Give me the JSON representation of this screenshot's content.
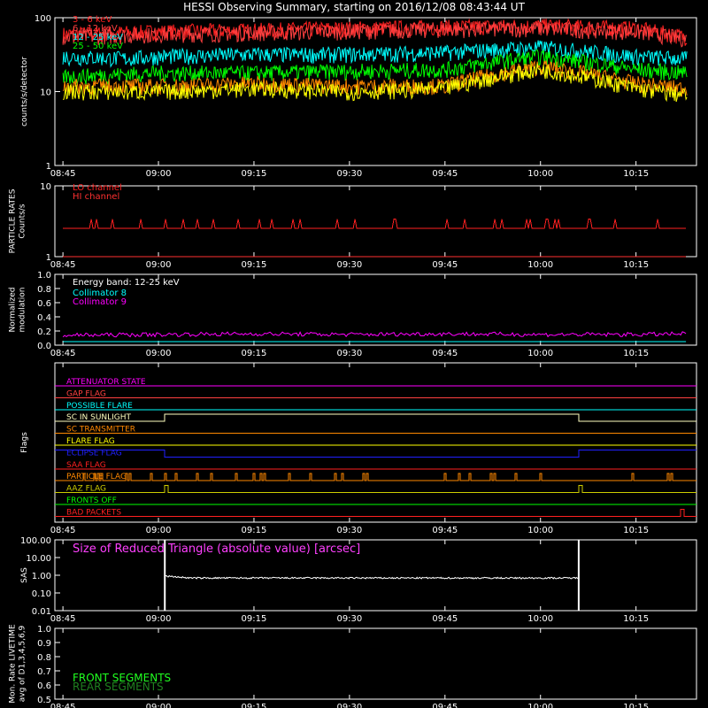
{
  "title": "HESSI Observing Summary, starting on 2016/12/08 08:43:44 UT",
  "time_ticks": [
    "08:45",
    "09:00",
    "09:15",
    "09:30",
    "09:45",
    "10:00",
    "10:15"
  ],
  "chart_data": [
    {
      "id": "lightcurves",
      "type": "line",
      "ylabel": "counts/s/detector",
      "yscale": "log",
      "ylim": [
        1,
        100
      ],
      "yticks": [
        "1",
        "10",
        "100"
      ],
      "series": [
        {
          "name": "3 - 6 keV",
          "color": "#ff2020",
          "x": [
            "08:45",
            "09:00",
            "09:15",
            "09:30",
            "09:45",
            "10:00",
            "10:15",
            "10:23"
          ],
          "y": [
            60,
            65,
            68,
            72,
            75,
            78,
            72,
            55
          ]
        },
        {
          "name": "6 - 12 keV",
          "color": "#ff4040",
          "x": [
            "08:45",
            "09:00",
            "09:15",
            "09:30",
            "09:45",
            "10:00",
            "10:15",
            "10:23"
          ],
          "y": [
            55,
            60,
            63,
            66,
            70,
            72,
            65,
            52
          ]
        },
        {
          "name": "12 - 25 keV",
          "color": "#00ffff",
          "x": [
            "08:45",
            "08:55",
            "09:00",
            "09:15",
            "09:30",
            "09:45",
            "10:00",
            "10:15",
            "10:23"
          ],
          "y": [
            30,
            28,
            30,
            32,
            32,
            34,
            40,
            30,
            28
          ]
        },
        {
          "name": "25 - 50 keV",
          "color": "#00ff00",
          "x": [
            "08:45",
            "09:00",
            "09:15",
            "09:30",
            "09:45",
            "10:00",
            "10:15",
            "10:23"
          ],
          "y": [
            16,
            18,
            18,
            19,
            20,
            30,
            20,
            18
          ]
        },
        {
          "name": "",
          "color": "#ff8800",
          "x": [
            "08:45",
            "09:00",
            "09:15",
            "09:30",
            "09:45",
            "10:00",
            "10:15",
            "10:23"
          ],
          "y": [
            12,
            12,
            13,
            12,
            12,
            22,
            13,
            11
          ]
        },
        {
          "name": "",
          "color": "#ffff00",
          "x": [
            "08:45",
            "09:00",
            "09:15",
            "09:30",
            "09:45",
            "10:00",
            "10:15",
            "10:23"
          ],
          "y": [
            10,
            10,
            11,
            10,
            11,
            20,
            11,
            9
          ]
        }
      ]
    },
    {
      "id": "particle",
      "type": "line",
      "ylabel": "PARTICLE RATES\nCounts/s",
      "yscale": "log",
      "ylim": [
        1,
        10
      ],
      "yticks": [
        "1",
        "10"
      ],
      "series": [
        {
          "name": "LO channel",
          "color": "#ff2020",
          "x": [
            "08:45",
            "09:00",
            "09:15",
            "09:30",
            "09:45",
            "10:00",
            "10:15",
            "10:23"
          ],
          "y": [
            2.5,
            2.5,
            2.5,
            2.5,
            2.5,
            2.8,
            2.5,
            2.5
          ]
        },
        {
          "name": "HI channel",
          "color": "#ff3030",
          "x": [
            "08:45",
            "10:23"
          ],
          "y": [
            1,
            1
          ]
        }
      ]
    },
    {
      "id": "modulation",
      "type": "line",
      "ylabel": "Normalized\nmodulation",
      "ylim": [
        0,
        1.0
      ],
      "yticks": [
        "0.0",
        "0.2",
        "0.4",
        "0.6",
        "0.8",
        "1.0"
      ],
      "annotation": "Energy band: 12-25 keV",
      "series": [
        {
          "name": "Collimator 8",
          "color": "#00ffff",
          "x": [
            "08:45",
            "10:23"
          ],
          "y": [
            0.05,
            0.05
          ]
        },
        {
          "name": "Collimator 9",
          "color": "#ff00ff",
          "x": [
            "08:45",
            "09:00",
            "09:15",
            "09:30",
            "09:45",
            "10:00",
            "10:15",
            "10:23"
          ],
          "y": [
            0.14,
            0.15,
            0.16,
            0.15,
            0.16,
            0.15,
            0.15,
            0.16
          ]
        }
      ]
    },
    {
      "id": "flags",
      "type": "line",
      "ylabel": "Flags",
      "flags": [
        {
          "name": "ATTENUATOR STATE",
          "color": "#ff00ff"
        },
        {
          "name": "GAP FLAG",
          "color": "#ff4040"
        },
        {
          "name": "POSSIBLE FLARE",
          "color": "#00ffff"
        },
        {
          "name": "SC IN SUNLIGHT",
          "color": "#ffffc0",
          "high_from": "09:01",
          "high_to": "10:06"
        },
        {
          "name": "SC TRANSMITTER",
          "color": "#ff8800"
        },
        {
          "name": "FLARE FLAG",
          "color": "#ffff00"
        },
        {
          "name": "ECLIPSE FLAG",
          "color": "#2020ff",
          "high_from": "08:45",
          "high_to": "09:01",
          "high_from2": "10:06",
          "high_to2": "10:23"
        },
        {
          "name": "SAA FLAG",
          "color": "#ff2020"
        },
        {
          "name": "PARTICLE FLAG",
          "color": "#ff8800",
          "spiky": true
        },
        {
          "name": "AAZ FLAG",
          "color": "#cccc00",
          "pulses": [
            "09:01",
            "10:06"
          ]
        },
        {
          "name": "FRONTS OFF",
          "color": "#00ff00"
        },
        {
          "name": "BAD PACKETS",
          "color": "#ff2020",
          "pulses": [
            "10:22"
          ]
        }
      ]
    },
    {
      "id": "sas",
      "type": "line",
      "ylabel": "SAS",
      "yscale": "log",
      "ylim": [
        0.01,
        100
      ],
      "yticks": [
        "0.01",
        "0.10",
        "1.00",
        "10.00",
        "100.00"
      ],
      "annotation": "Size of Reduced Triangle (absolute value) [arcsec]",
      "series": [
        {
          "name": "",
          "color": "#ffffff",
          "x": [
            "09:01",
            "09:05",
            "09:30",
            "10:00",
            "10:06"
          ],
          "y": [
            0.9,
            0.7,
            0.7,
            0.7,
            0.7
          ]
        }
      ]
    },
    {
      "id": "livetime",
      "type": "line",
      "ylabel": "Mon. Rate LIVETIME\navg of D1,3,4,5,6,9",
      "ylim": [
        0.5,
        1.0
      ],
      "yticks": [
        "0.5",
        "0.6",
        "0.7",
        "0.8",
        "0.9",
        "1.0"
      ],
      "series": [
        {
          "name": "FRONT SEGMENTS",
          "color": "#20ff20",
          "x": [],
          "y": []
        },
        {
          "name": "REAR SEGMENTS",
          "color": "#208020",
          "x": [],
          "y": []
        }
      ]
    }
  ]
}
